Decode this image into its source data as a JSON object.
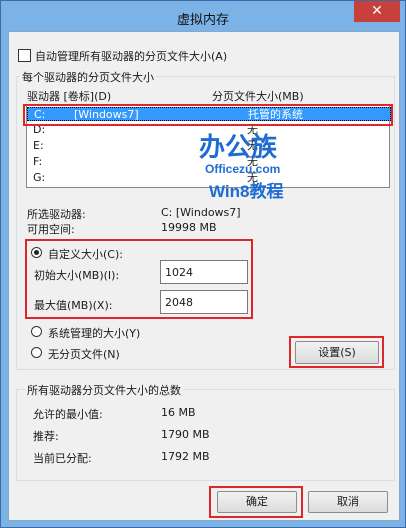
{
  "window": {
    "title": "虚拟内存",
    "close_glyph": "✕"
  },
  "auto_manage": {
    "label": "自动管理所有驱动器的分页文件大小(A)",
    "checked": false
  },
  "drives_group": {
    "label": "每个驱动器的分页文件大小",
    "col_drive": "驱动器 [卷标](D)",
    "col_size": "分页文件大小(MB)",
    "rows": [
      {
        "drive": "C:",
        "label": "[Windows7]",
        "size": "托管的系统",
        "selected": true
      },
      {
        "drive": "D:",
        "label": "",
        "size": "无"
      },
      {
        "drive": "E:",
        "label": "",
        "size": "无"
      },
      {
        "drive": "F:",
        "label": "",
        "size": "无"
      },
      {
        "drive": "G:",
        "label": "",
        "size": "无"
      }
    ],
    "selected_drive_label": "所选驱动器:",
    "selected_drive_value": "C:  [Windows7]",
    "free_space_label": "可用空间:",
    "free_space_value": "19998 MB",
    "custom_size": "自定义大小(C):",
    "initial_label": "初始大小(MB)(I):",
    "initial_value": "1024",
    "max_label": "最大值(MB)(X):",
    "max_value": "2048",
    "system_managed": "系统管理的大小(Y)",
    "no_paging": "无分页文件(N)",
    "set_button": "设置(S)",
    "selected_option": "custom"
  },
  "totals_group": {
    "label": "所有驱动器分页文件大小的总数",
    "min_label": "允许的最小值:",
    "min_value": "16 MB",
    "recommended_label": "推荐:",
    "recommended_value": "1790 MB",
    "allocated_label": "当前已分配:",
    "allocated_value": "1792 MB"
  },
  "buttons": {
    "ok": "确定",
    "cancel": "取消"
  },
  "watermark": {
    "line1": "办公族",
    "line2": "Officezu.com",
    "line3": "Win8教程"
  },
  "colors": {
    "title_bar": "#7bb3e6",
    "selection": "#3399ff",
    "highlight_box": "#e0262b",
    "close": "#c7403c"
  }
}
